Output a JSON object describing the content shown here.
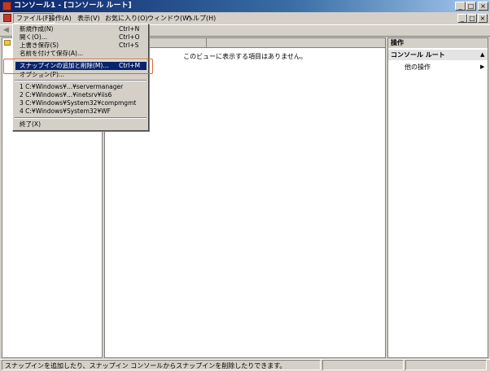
{
  "window": {
    "title": "コンソール1 - [コンソール ルート]",
    "minimize_glyph": "_",
    "maximize_glyph": "□",
    "close_glyph": "×"
  },
  "menubar": {
    "items": [
      "ファイル(F)",
      "操作(A)",
      "表示(V)",
      "お気に入り(O)",
      "ウィンドウ(W)",
      "ヘルプ(H)"
    ]
  },
  "file_menu": {
    "items": [
      {
        "label": "新規作成(N)",
        "shortcut": "Ctrl+N"
      },
      {
        "label": "開く(O)...",
        "shortcut": "Ctrl+O"
      },
      {
        "label": "上書き保存(S)",
        "shortcut": "Ctrl+S"
      },
      {
        "label": "名前を付けて保存(A)...",
        "shortcut": ""
      },
      {
        "label": "スナップインの追加と削除(M)...",
        "shortcut": "Ctrl+M"
      },
      {
        "label": "オプション(P)...",
        "shortcut": ""
      },
      {
        "label": "1 C:¥Windows¥...¥servermanager",
        "shortcut": ""
      },
      {
        "label": "2 C:¥Windows¥...¥inetsrv¥iis6",
        "shortcut": ""
      },
      {
        "label": "3 C:¥Windows¥System32¥compmgmt",
        "shortcut": ""
      },
      {
        "label": "4 C:¥Windows¥System32¥WF",
        "shortcut": ""
      },
      {
        "label": "終了(X)",
        "shortcut": ""
      }
    ],
    "highlighted_index": 4
  },
  "center": {
    "empty_message": "このビューに表示する項目はありません。"
  },
  "actions": {
    "header": "操作",
    "section": "コンソール ルート",
    "other": "他の操作"
  },
  "statusbar": {
    "text": "スナップインを追加したり、スナップイン コンソールからスナップインを削除したりできます。"
  },
  "colors": {
    "highlight": "#0a246a",
    "callout": "#e0682a",
    "chrome": "#d4d0c8"
  }
}
